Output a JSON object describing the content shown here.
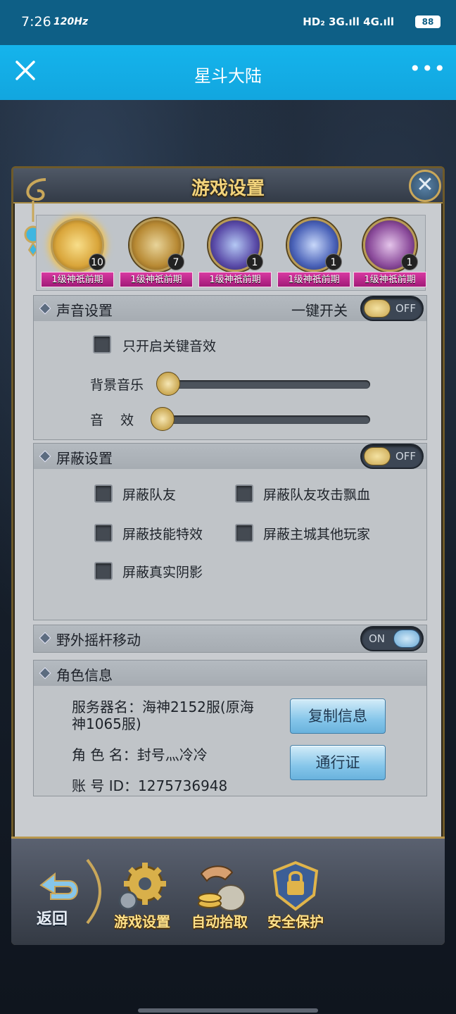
{
  "status_bar": {
    "time": "7:26",
    "refresh": "120Hz",
    "network": "HD₂ 3G.ıll 4G.ıll",
    "battery": "88"
  },
  "app_bar": {
    "title": "星斗大陆",
    "more": "•••"
  },
  "settings": {
    "title": "游戏设置",
    "close": "✕",
    "heroes": [
      {
        "tag": "1级神祇前期",
        "count": "10",
        "color": "#d9a53a"
      },
      {
        "tag": "1级神祇前期",
        "count": "7",
        "color": "#b88a34"
      },
      {
        "tag": "1级神祇前期",
        "count": "1",
        "color": "#5a4ba8"
      },
      {
        "tag": "1级神祇前期",
        "count": "1",
        "color": "#4a62b8"
      },
      {
        "tag": "1级神祇前期",
        "count": "1",
        "color": "#8a4a9a"
      }
    ],
    "sound": {
      "title": "声音设置",
      "master_label": "一键开关",
      "master_state": "OFF",
      "key_only": "只开启关键音效",
      "bgm_label": "背景音乐",
      "sfx_label": "音    效",
      "bgm_level": 0,
      "sfx_level": 0
    },
    "shield": {
      "title": "屏蔽设置",
      "state": "OFF",
      "options": [
        "屏蔽队友",
        "屏蔽队友攻击飘血",
        "屏蔽技能特效",
        "屏蔽主城其他玩家",
        "屏蔽真实阴影"
      ]
    },
    "joystick": {
      "title": "野外摇杆移动",
      "state": "ON"
    },
    "role": {
      "title": "角色信息",
      "server_line1": "服务器名：海神2152服(原海",
      "server_line2": "神1065服)",
      "name": "角 色 名：封号灬冷冷",
      "account": "账 号 ID：1275736948",
      "copy_button": "复制信息",
      "pass_button": "通行证"
    }
  },
  "bottom_nav": {
    "back": "返回",
    "items": [
      "游戏设置",
      "自动拾取",
      "安全保护"
    ]
  },
  "colors": {
    "status_bar": "#0e5f86",
    "app_bar": "#12a6df",
    "gold": "#f2d37c",
    "hero_tag": "#c02a8e"
  }
}
